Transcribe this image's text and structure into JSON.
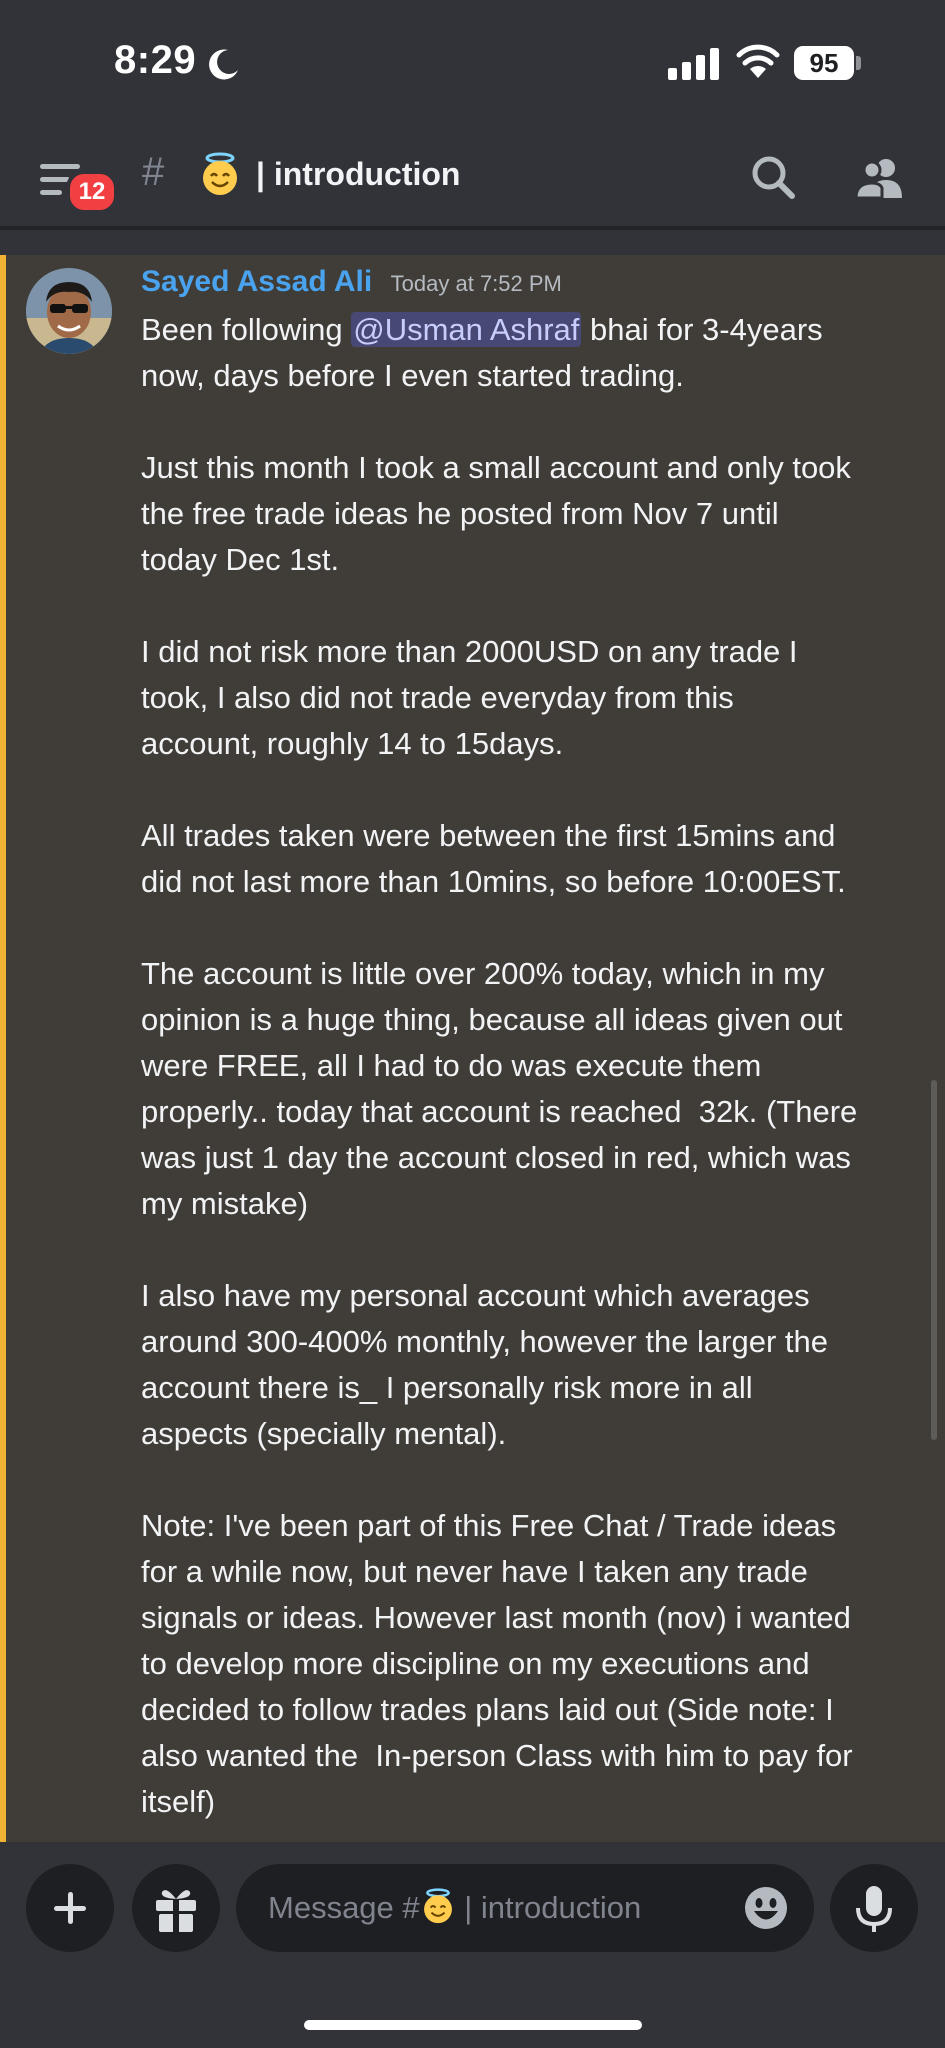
{
  "status_bar": {
    "time": "8:29",
    "battery": "95"
  },
  "header": {
    "badge_count": "12",
    "hash_symbol": "#",
    "channel_name": "| introduction"
  },
  "message": {
    "author": "Sayed Assad Ali",
    "timestamp": "Today at 7:52 PM",
    "body_prefix": "Been following ",
    "mention": "@Usman Ashraf",
    "body_rest": " bhai for 3-4years\nnow, days before I even started trading.\n\nJust this month I took a small account and only took\nthe free trade ideas he posted from Nov 7 until\ntoday Dec 1st.\n\nI did not risk more than 2000USD on any trade I\ntook, I also did not trade everyday from this\naccount, roughly 14 to 15days.\n\nAll trades taken were between the first 15mins and\ndid not last more than 10mins, so before 10:00EST.\n\nThe account is little over 200% today, which in my\nopinion is a huge thing, because all ideas given out\nwere FREE, all I had to do was execute them\nproperly.. today that account is reached  32k. (There\nwas just 1 day the account closed in red, which was\nmy mistake)\n\nI also have my personal account which averages\naround 300-400% monthly, however the larger the\naccount there is_ I personally risk more in all\naspects (specially mental).\n\nNote: I've been part of this Free Chat / Trade ideas\nfor a while now, but never have I taken any trade\nsignals or ideas. However last month (nov) i wanted\nto develop more discipline on my executions and\ndecided to follow trades plans laid out (Side note: I\nalso wanted the  In-person Class with him to pay for\nitself)"
  },
  "composer": {
    "placeholder_prefix": "Message #",
    "placeholder_suffix": " | introduction"
  },
  "colors": {
    "mention_bar": "#f0b232",
    "author": "#4aa3ee",
    "badge": "#f23f42",
    "highlight_bg": "#403d38"
  },
  "icons": [
    "moon-icon",
    "signal-icon",
    "wifi-icon",
    "battery-icon",
    "menu-icon",
    "hash-icon",
    "angel-emoji-icon",
    "search-icon",
    "members-icon",
    "plus-icon",
    "gift-icon",
    "emoji-icon",
    "microphone-icon"
  ]
}
